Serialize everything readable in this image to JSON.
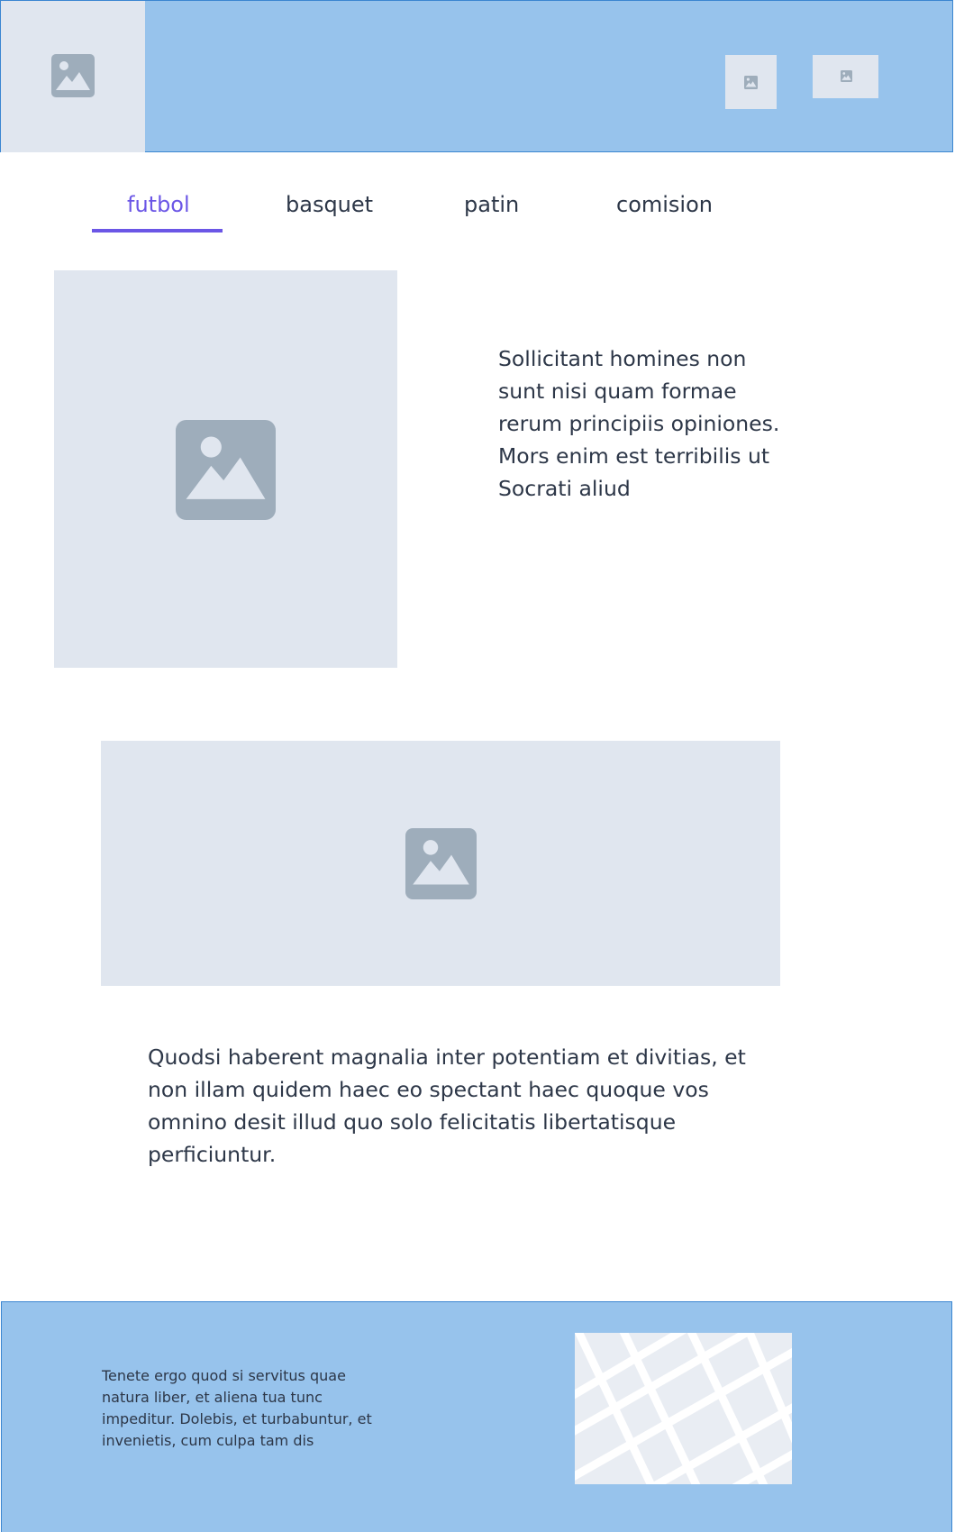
{
  "header": {
    "logo_icon": "image-placeholder-icon",
    "thumb_1_icon": "image-placeholder-icon",
    "thumb_2_icon": "image-placeholder-icon",
    "colors": {
      "background": "#97c3ec",
      "border": "#3b86d1",
      "placeholder": "#e0e6ef"
    }
  },
  "tabs": {
    "items": [
      {
        "label": "futbol",
        "active": true
      },
      {
        "label": "basquet",
        "active": false
      },
      {
        "label": "patin",
        "active": false
      },
      {
        "label": "comision",
        "active": false
      }
    ],
    "active_color": "#6b56e6"
  },
  "section_one": {
    "image_icon": "image-placeholder-icon",
    "text": "Sollicitant homines non sunt nisi quam formae rerum principiis opiniones. Mors enim est terribilis ut Socrati aliud"
  },
  "section_two": {
    "image_icon": "image-placeholder-icon",
    "text": "Quodsi haberent magnalia inter potentiam et divitias, et non illam quidem haec eo spectant haec quoque vos omnino desit illud quo solo felicitatis libertatisque perficiuntur."
  },
  "footer": {
    "text": "Tenete ergo quod si servitus quae natura liber, et aliena tua tunc impeditur. Dolebis, et turbabuntur, et invenietis, cum culpa tam dis",
    "map_icon": "map-placeholder"
  }
}
